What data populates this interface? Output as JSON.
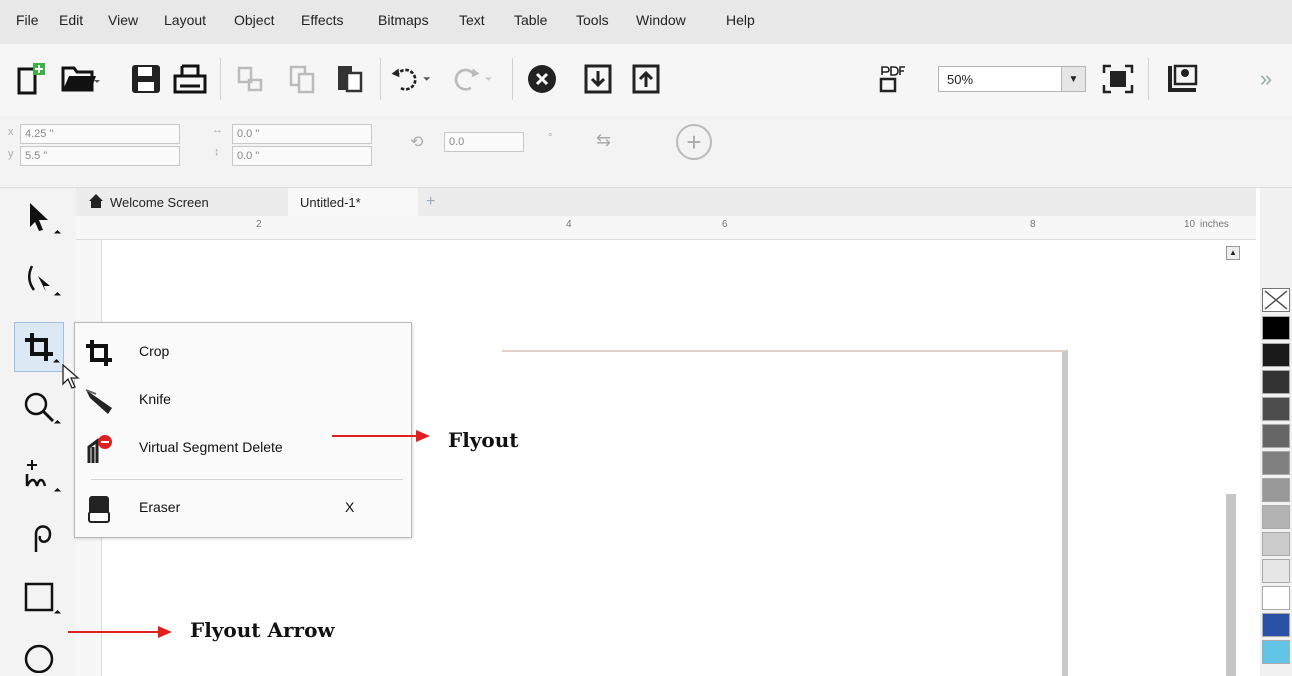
{
  "menu": [
    "File",
    "Edit",
    "View",
    "Layout",
    "Object",
    "Effects",
    "Bitmaps",
    "Text",
    "Table",
    "Tools",
    "Window",
    "Help"
  ],
  "toolbar": {
    "zoom_value": "50%",
    "icons": [
      "new-document",
      "open",
      "save",
      "print",
      "cut",
      "copy",
      "paste",
      "undo",
      "redo",
      "search-content",
      "import",
      "export",
      "publish-pdf",
      "full-screen",
      "options",
      "more"
    ]
  },
  "properties": {
    "x": "4.25 \"",
    "y": "5.5 \"",
    "width": "0.0 \"",
    "height": "0.0 \"",
    "rotation": "0.0"
  },
  "tabs": {
    "welcome": "Welcome Screen",
    "document": "Untitled-1*"
  },
  "ruler": {
    "labels": [
      "2",
      "4",
      "6",
      "8",
      "10"
    ],
    "unit": "inches"
  },
  "flyout": {
    "items": [
      {
        "label": "Crop",
        "icon": "crop-icon"
      },
      {
        "label": "Knife",
        "icon": "knife-icon"
      },
      {
        "label": "Virtual Segment Delete",
        "icon": "virtual-segment-delete-icon"
      },
      {
        "label": "Eraser",
        "icon": "eraser-icon",
        "shortcut": "X"
      }
    ]
  },
  "annotations": {
    "flyout": "Flyout",
    "flyout_arrow": "Flyout Arrow"
  },
  "palette_colors": [
    "#000000",
    "#1a1a1a",
    "#333333",
    "#4d4d4d",
    "#666666",
    "#808080",
    "#999999",
    "#b3b3b3",
    "#cccccc",
    "#e6e6e6",
    "#ffffff",
    "#2a4fa6",
    "#5fc4e6"
  ],
  "colors": {
    "annotation_arrow": "#e02020",
    "active_tool": "#dce9f5"
  }
}
